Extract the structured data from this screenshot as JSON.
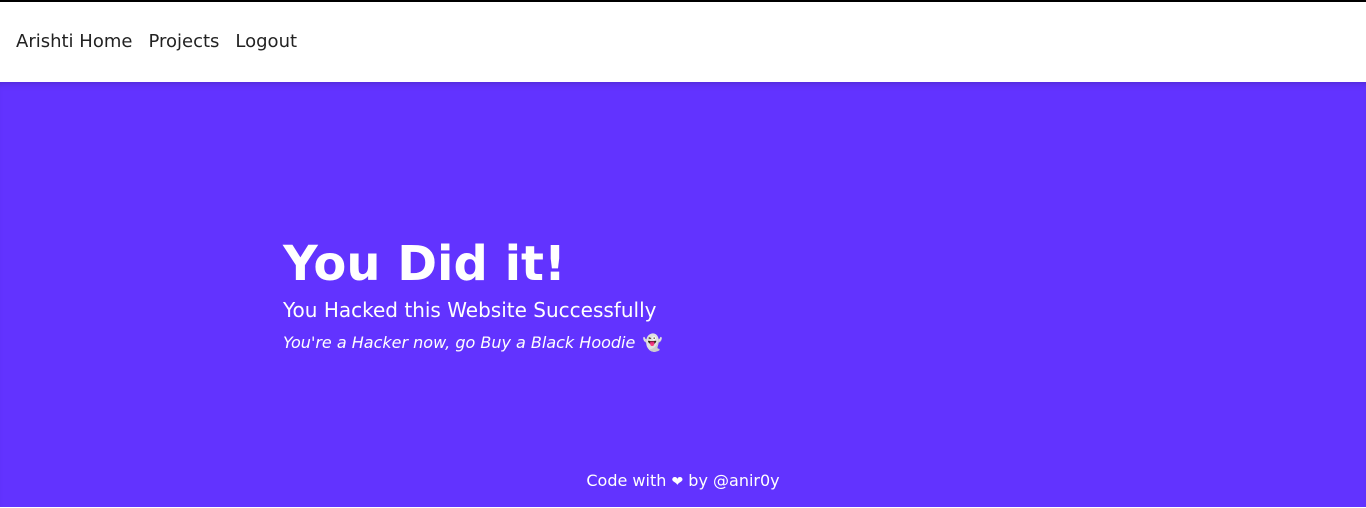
{
  "nav": {
    "links": [
      {
        "label": "Arishti Home"
      },
      {
        "label": "Projects"
      },
      {
        "label": "Logout"
      }
    ]
  },
  "hero": {
    "title": "You Did it!",
    "subtitle": "You Hacked this Website Successfully",
    "tagline": "You're a Hacker now, go Buy a Black Hoodie",
    "tagline_icon": "👻"
  },
  "footer": {
    "prefix": "Code with",
    "heart": "❤",
    "suffix": "by @anir0y"
  },
  "colors": {
    "hero_background": "#6233ff",
    "nav_background": "#ffffff",
    "text_on_hero": "#ffffff",
    "nav_text": "#222222"
  }
}
